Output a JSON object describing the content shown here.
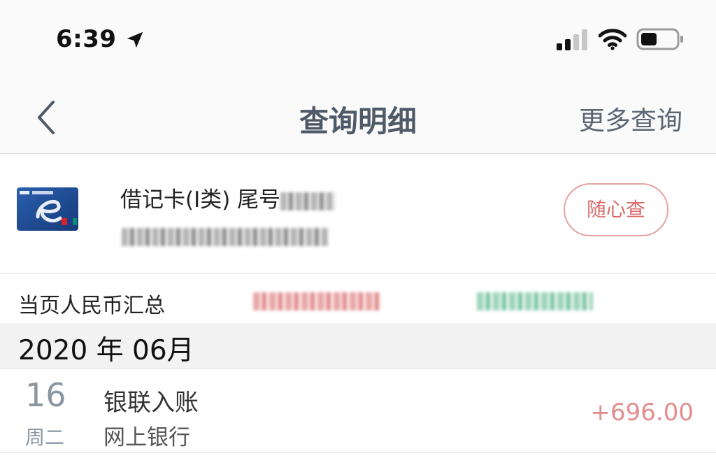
{
  "status_bar": {
    "time": "6:39",
    "location_icon": "location-arrow-icon",
    "signal_icon": "cellular-signal-icon",
    "wifi_icon": "wifi-icon",
    "battery_icon": "battery-icon"
  },
  "nav": {
    "back_icon": "chevron-left-icon",
    "title": "查询明细",
    "more_label": "更多查询"
  },
  "card": {
    "icon": "bank-card-icon",
    "title_prefix": "借记卡(Ⅰ类) 尾号",
    "random_query_label": "随心查"
  },
  "summary": {
    "label": "当页人民币汇总"
  },
  "month": {
    "label": "2020 年 06月"
  },
  "transactions": [
    {
      "day": "16",
      "weekday": "周二",
      "title": "银联入账",
      "channel": "网上银行",
      "amount": "+696.00"
    }
  ],
  "colors": {
    "nav_text": "#4f5a68",
    "income": "#e28e8e",
    "button_border": "#e7a1a1",
    "date_text": "#8c96a1"
  }
}
